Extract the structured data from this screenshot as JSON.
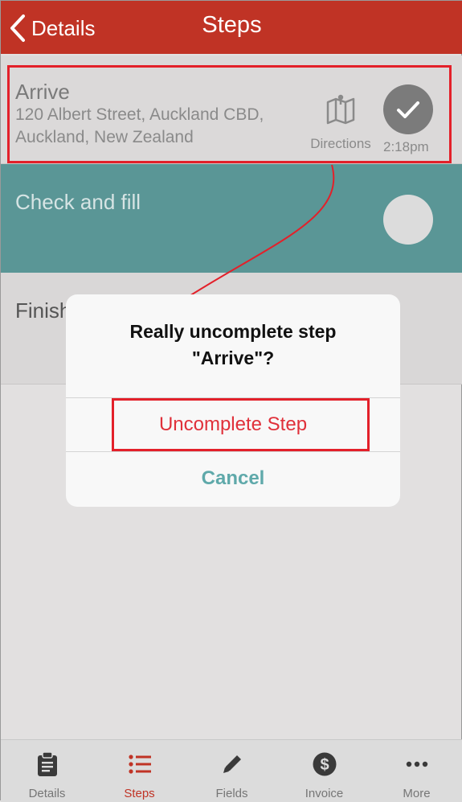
{
  "colors": {
    "brand": "#c03325",
    "teal": "#5a9696",
    "destructive": "#e0303a",
    "cancel": "#5fa9aa",
    "annotation": "#e3202a"
  },
  "navbar": {
    "back_label": "Details",
    "title": "Steps",
    "back_icon": "chevron-left-icon"
  },
  "steps": [
    {
      "title": "Arrive",
      "address": "120 Albert Street, Auckland CBD, Auckland, New Zealand",
      "directions_label": "Directions",
      "time": "2:18pm",
      "completed": true
    },
    {
      "title": "Check and fill",
      "completed": false
    },
    {
      "title": "Finish"
    }
  ],
  "dialog": {
    "message_line1": "Really uncomplete step",
    "message_line2": "\"Arrive\"?",
    "confirm_label": "Uncomplete Step",
    "cancel_label": "Cancel"
  },
  "tabbar": {
    "active": "Steps",
    "items": [
      {
        "label": "Details",
        "icon": "clipboard-icon"
      },
      {
        "label": "Steps",
        "icon": "list-icon"
      },
      {
        "label": "Fields",
        "icon": "pencil-icon"
      },
      {
        "label": "Invoice",
        "icon": "dollar-icon"
      },
      {
        "label": "More",
        "icon": "more-dots-icon"
      }
    ]
  }
}
